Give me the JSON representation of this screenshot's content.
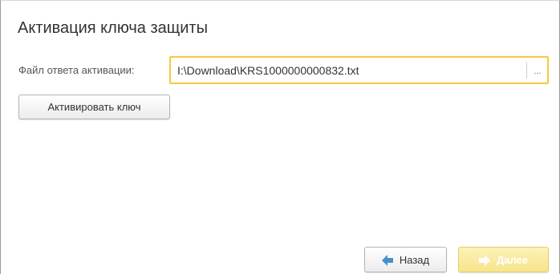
{
  "dialog": {
    "title": "Активация ключа защиты"
  },
  "activation_file": {
    "label": "Файл ответа активации:",
    "value": "I:\\Download\\KRS1000000000832.txt",
    "browse_label": "..."
  },
  "buttons": {
    "activate_label": "Активировать ключ",
    "back_label": "Назад",
    "next_label": "Далее"
  },
  "colors": {
    "focus_border": "#f5c842",
    "back_arrow": "#4a90c8",
    "next_arrow_disabled": "#ffffff",
    "next_button_disabled": "#f7e48c"
  }
}
